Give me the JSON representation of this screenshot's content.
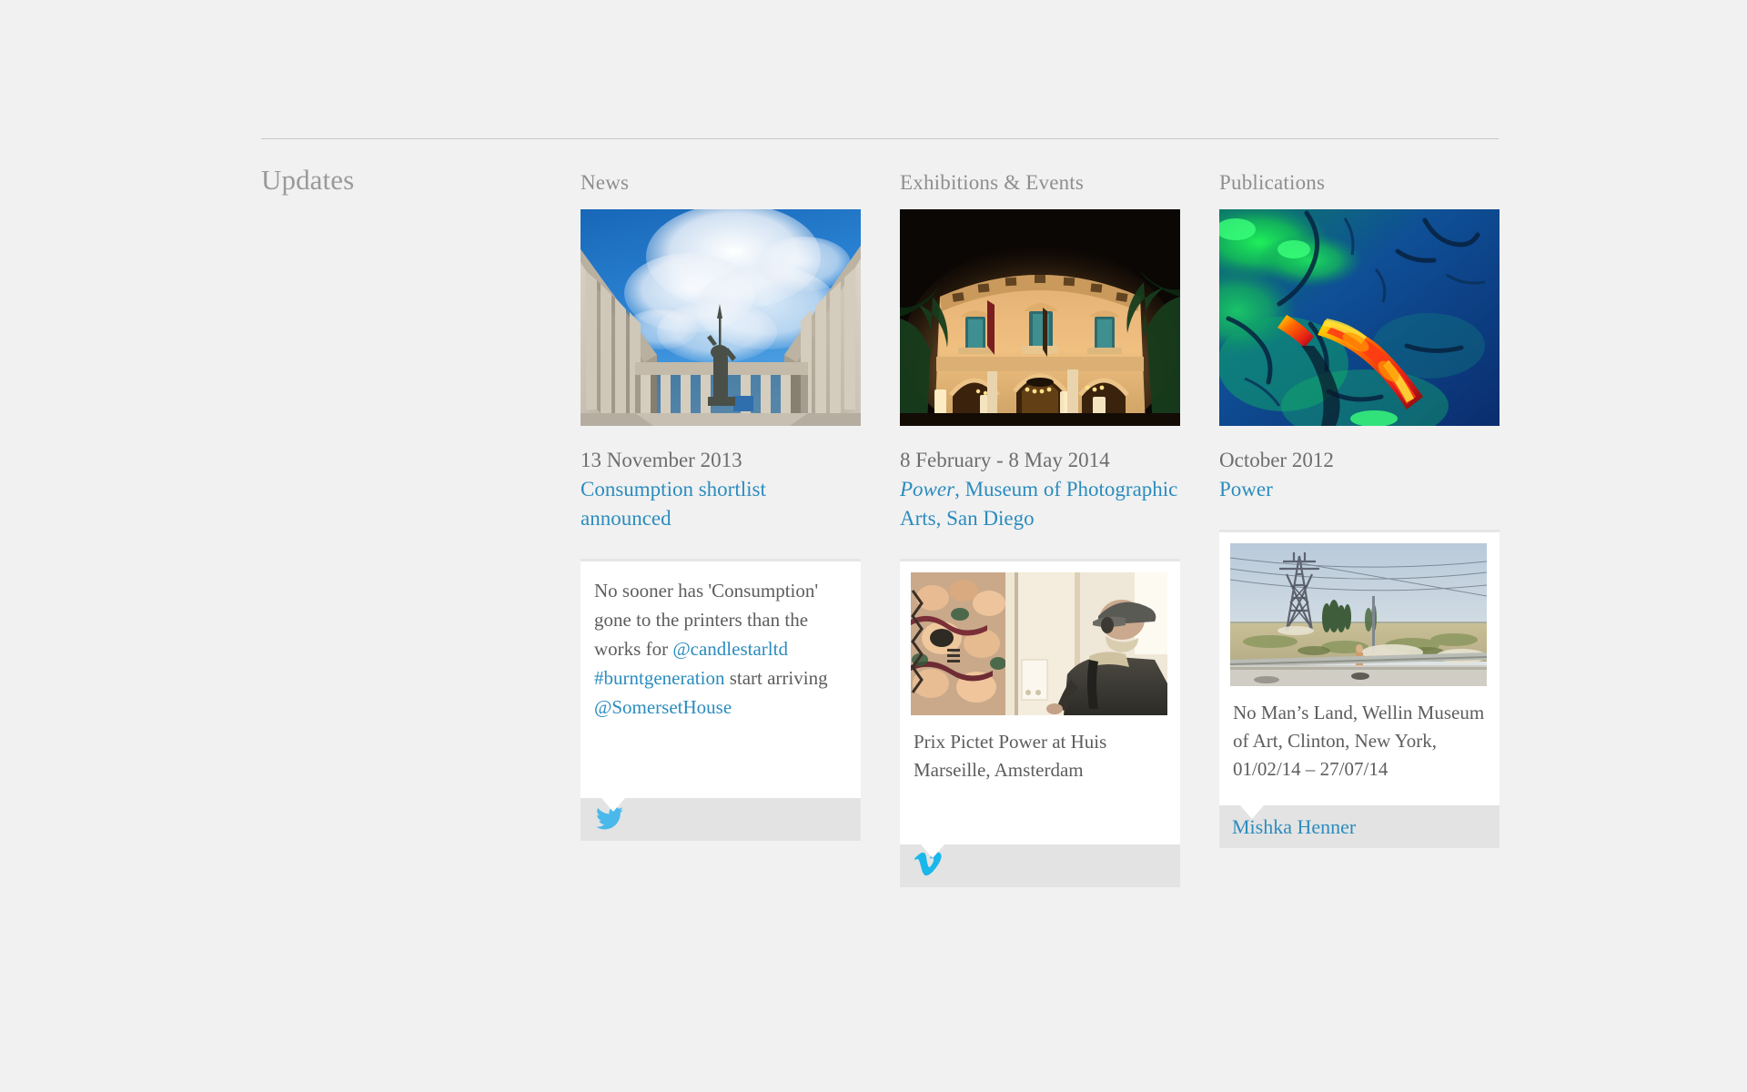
{
  "section": {
    "label": "Updates"
  },
  "colors": {
    "link": "#2b8cbe",
    "text": "#6d6d6d",
    "muted": "#9a9a9a",
    "page_bg": "#f1f1f1",
    "card_bg": "#ffffff",
    "footer_bg": "#e3e3e3",
    "twitter": "#4ab8ea",
    "vimeo": "#1ab7ea"
  },
  "columns": [
    {
      "title": "News",
      "hero": {
        "name": "palais-de-tokyo-columns-photo",
        "alt": "Neoclassical colonnaded building with statue against blue sky and clouds"
      },
      "date": "13 November 2013",
      "link_text": "Consumption shortlist announced",
      "card": {
        "type": "twitter",
        "icon": "twitter-bird-icon",
        "text_parts": [
          {
            "text": "No sooner has 'Consumption' gone to the printers than the works for ",
            "link": false
          },
          {
            "text": "@candlestarltd",
            "link": true
          },
          {
            "text": " ",
            "link": false
          },
          {
            "text": "#burntgeneration",
            "link": true
          },
          {
            "text": " start arriving ",
            "link": false
          },
          {
            "text": "@SomersetHouse",
            "link": true
          }
        ]
      }
    },
    {
      "title": "Exhibitions & Events",
      "hero": {
        "name": "illuminated-baroque-building-night-photo",
        "alt": "Ornate building lit at night flanked by palm trees"
      },
      "date": "8 February - 8 May 2014",
      "link_italic": "Power",
      "link_rest": ", Museum of Photographic Arts, San Diego",
      "card": {
        "type": "vimeo",
        "icon": "vimeo-icon",
        "thumb": {
          "name": "gallery-visitor-video-thumbnail",
          "alt": "Man in flat cap viewing a painting in a gallery"
        },
        "caption": "Prix Pictet Power at Huis Marseille, Amsterdam"
      }
    },
    {
      "title": "Publications",
      "hero": {
        "name": "false-color-satellite-thermal-photo",
        "alt": "False colour satellite image with green, blue and red thermal areas"
      },
      "date": "October 2012",
      "link_text": "Power",
      "card": {
        "type": "publication",
        "thumb": {
          "name": "no-mans-land-roadside-pylon-photo",
          "alt": "Arid roadside landscape with electricity pylon and figure by crash barrier"
        },
        "caption": "No Man’s Land, Wellin Museum of Art, Clinton, New York, 01/02/14 – 27/07/14",
        "footer_link": "Mishka Henner"
      }
    }
  ]
}
